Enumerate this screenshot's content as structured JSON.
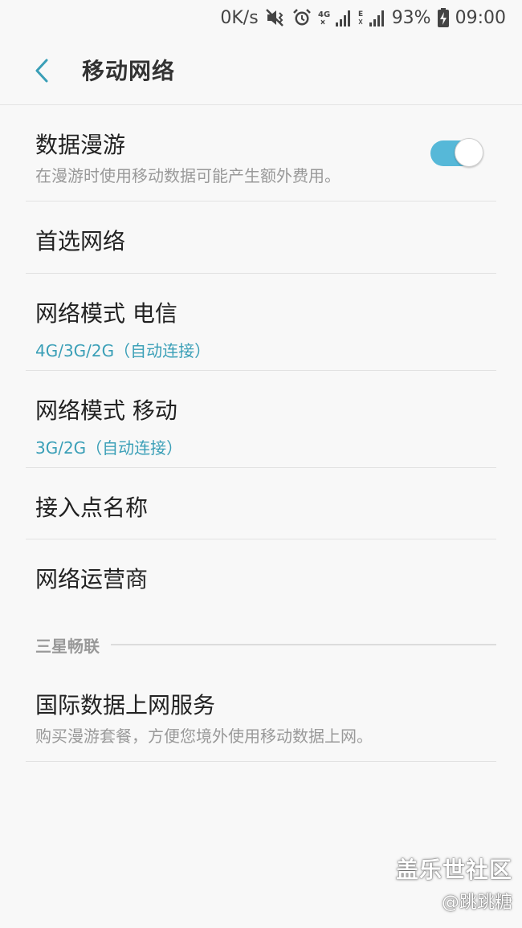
{
  "status_bar": {
    "speed": "0K/s",
    "network_1": "4G",
    "network_2": "E",
    "battery": "93%",
    "time": "09:00",
    "icons": [
      "mute-vibrate-icon",
      "alarm-icon",
      "signal-icon",
      "signal-icon",
      "battery-charging-icon"
    ]
  },
  "app_bar": {
    "back_icon": "chevron-left-icon",
    "title": "移动网络"
  },
  "settings": {
    "data_roaming": {
      "title": "数据漫游",
      "subtitle": "在漫游时使用移动数据可能产生额外费用。",
      "enabled": true
    },
    "preferred_network": {
      "title": "首选网络"
    },
    "network_mode_telecom": {
      "title": "网络模式 电信",
      "value": "4G/3G/2G（自动连接）"
    },
    "network_mode_mobile": {
      "title": "网络模式 移动",
      "value": "3G/2G（自动连接）"
    },
    "apn": {
      "title": "接入点名称"
    },
    "network_operator": {
      "title": "网络运营商"
    }
  },
  "section_samsung": {
    "label": "三星畅联"
  },
  "intl_data": {
    "title": "国际数据上网服务",
    "subtitle": "购买漫游套餐，方便您境外使用移动数据上网。"
  },
  "watermark": {
    "main": "盖乐世社区",
    "sub": "@跳跳糖"
  },
  "colors": {
    "accent": "#3a9fb7",
    "toggle_track": "#56b8d8",
    "background": "#f8f8f8"
  }
}
